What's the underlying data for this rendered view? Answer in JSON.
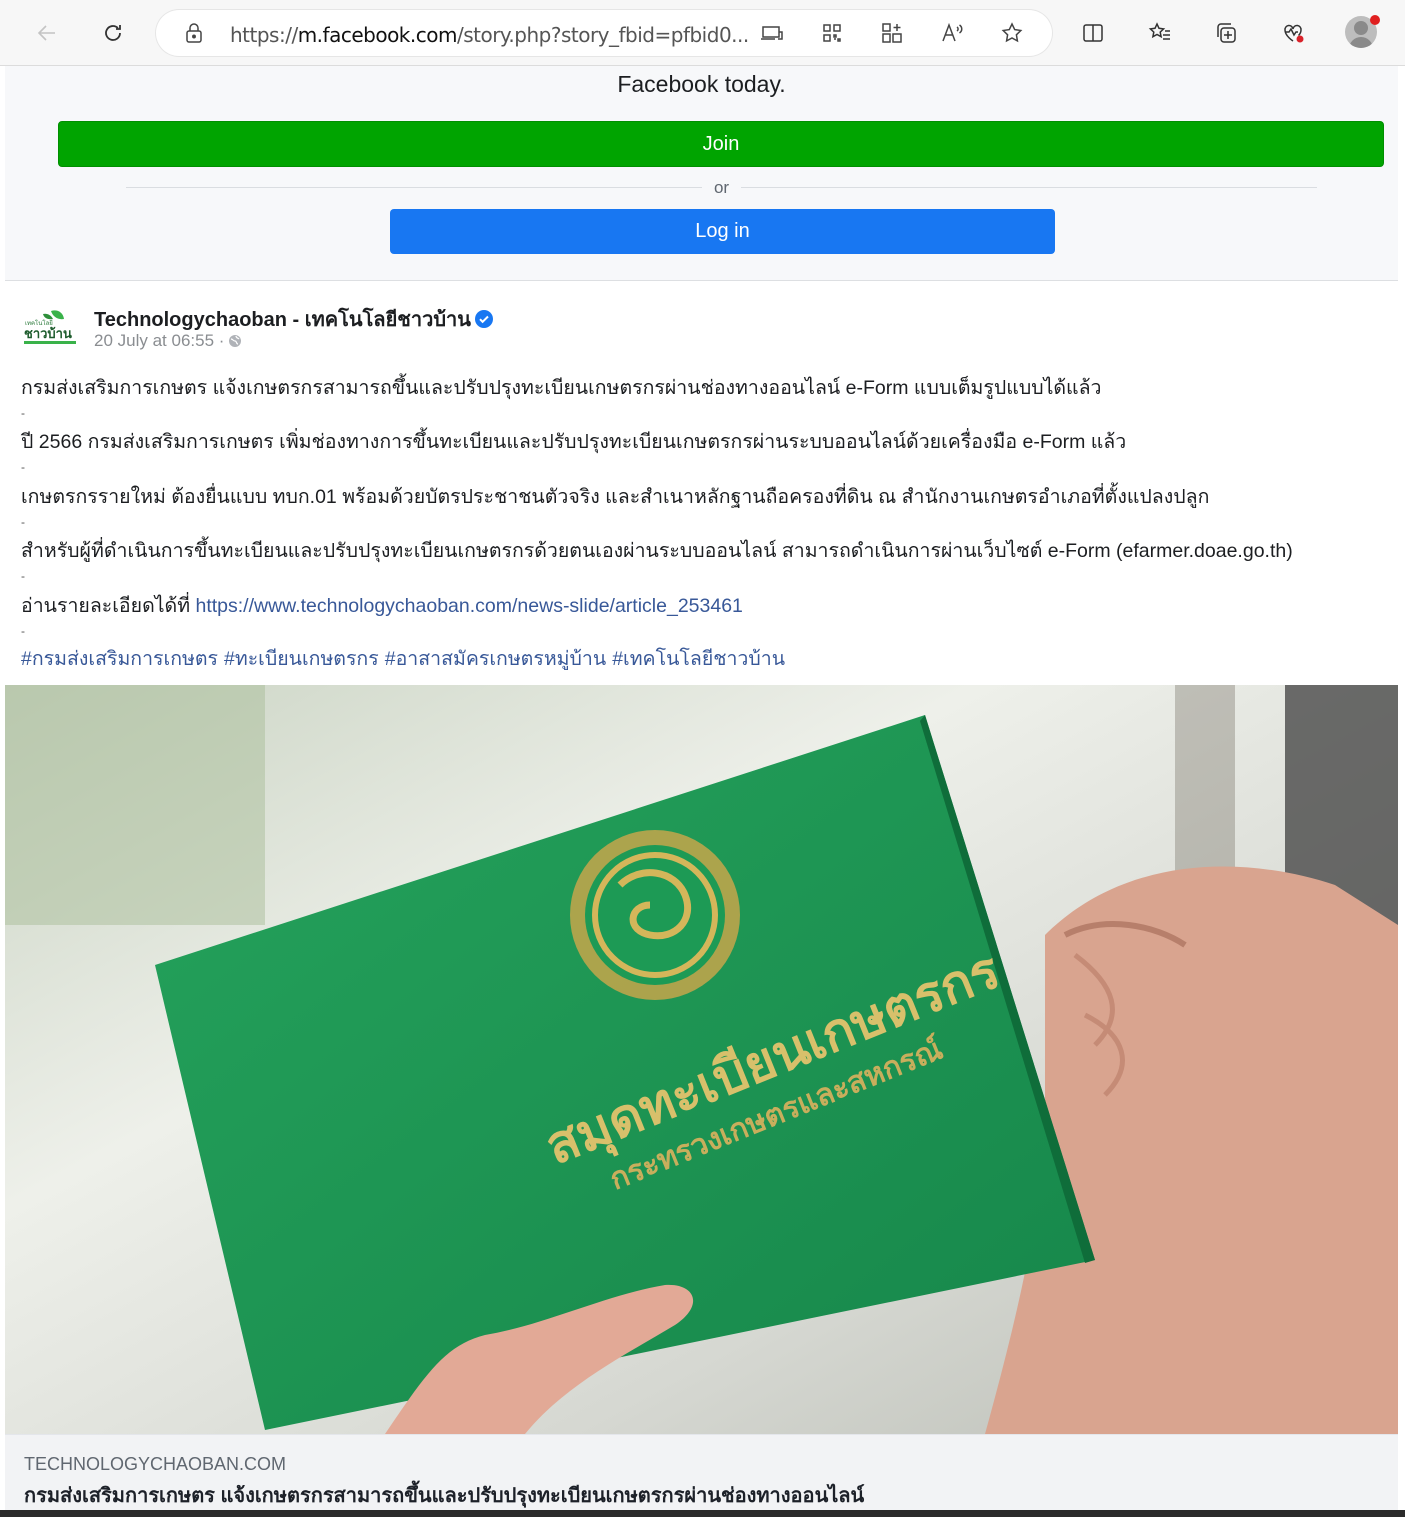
{
  "browser": {
    "url_prefix": "https://",
    "url_host": "m.facebook.com",
    "url_rest": "/story.php?story_fbid=pfbid0..."
  },
  "signup": {
    "message": "Facebook today.",
    "join_label": "Join",
    "or_label": "or",
    "login_label": "Log in"
  },
  "post": {
    "page_name": "Technologychaoban - เทคโนโลยีชาวบ้าน",
    "timestamp": "20 July at 06:55 ·",
    "paragraphs": [
      "กรมส่งเสริมการเกษตร แจ้งเกษตรกรสามารถขึ้นและปรับปรุงทะเบียนเกษตรกรผ่านช่องทางออนไลน์ e-Form แบบเต็มรูปแบบได้แล้ว",
      "ปี 2566 กรมส่งเสริมการเกษตร เพิ่มช่องทางการขึ้นทะเบียนและปรับปรุงทะเบียนเกษตรกรผ่านระบบออนไลน์ด้วยเครื่องมือ e-Form แล้ว",
      "เกษตรกรรายใหม่ ต้องยื่นแบบ ทบก.01 พร้อมด้วยบัตรประชาชนตัวจริง และสำเนาหลักฐานถือครองที่ดิน ณ สำนักงานเกษตรอำเภอที่ตั้งแปลงปลูก",
      "สำหรับผู้ที่ดำเนินการขึ้นทะเบียนและปรับปรุงทะเบียนเกษตรกรด้วยตนเองผ่านระบบออนไลน์ สามารถดำเนินการผ่านเว็บไซต์ e-Form (efarmer.doae.go.th)"
    ],
    "separator": "-",
    "read_more_prefix": "อ่านรายละเอียดได้ที่ ",
    "read_more_link": "https://www.technologychaoban.com/news-slide/article_253461",
    "hashtags": [
      "#กรมส่งเสริมการเกษตร",
      "#ทะเบียนเกษตรกร",
      "#อาสาสมัครเกษตรหมู่บ้าน",
      "#เทคโนโลยีชาวบ้าน"
    ],
    "photo_book_title": "สมุดทะเบียนเกษตรกร",
    "photo_book_subtitle": "กระทรวงเกษตรและสหกรณ์",
    "logo_text": "ชาวบ้าน"
  },
  "link_preview": {
    "domain": "TECHNOLOGYCHAOBAN.COM",
    "title": "กรมส่งเสริมการเกษตร แจ้งเกษตรกรสามารถขึ้นและปรับปรุงทะเบียนเกษตรกรผ่านช่องทางออนไลน์"
  },
  "colors": {
    "join": "#00a400",
    "login": "#1877f2",
    "link": "#385898",
    "verified": "#1877f2",
    "book": "#1d9a55"
  },
  "icons": [
    "back-icon",
    "refresh-icon",
    "lock-icon",
    "screen-cast-icon",
    "qr-code-icon",
    "app-install-icon",
    "read-aloud-icon",
    "star-icon",
    "split-screen-icon",
    "favorites-icon",
    "collections-icon",
    "health-icon",
    "profile-icon",
    "verified-icon",
    "globe-icon"
  ]
}
